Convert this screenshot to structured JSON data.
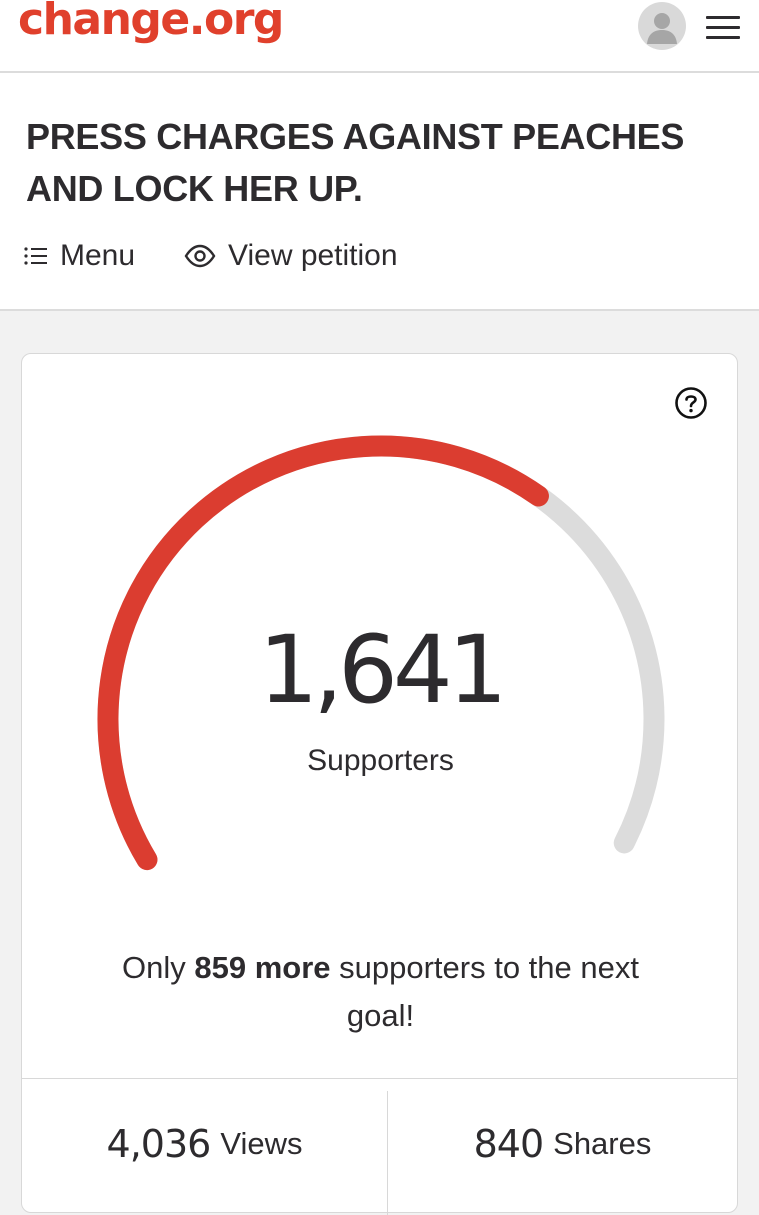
{
  "header": {
    "logo_text": "change.org",
    "brand_color": "#e0402c",
    "avatar_icon": "user-avatar-icon",
    "menu_icon": "hamburger-menu-icon"
  },
  "petition": {
    "title": "PRESS CHARGES AGAINST PEACHES AND LOCK HER UP.",
    "nav": {
      "menu_label": "Menu",
      "menu_icon": "list-icon",
      "view_label": "View petition",
      "view_icon": "eye-icon"
    }
  },
  "progress": {
    "help_icon": "question-circle-icon",
    "supporters_count": "1,641",
    "supporters_label": "Supporters",
    "goal_total": 2500,
    "supporters_value": 1641,
    "fill_fraction": 0.6564,
    "fill_color": "#db3d30",
    "track_color": "#dcdcdc",
    "goal_prefix": "Only ",
    "goal_bold": "859 more",
    "goal_suffix": " supporters to the next goal!"
  },
  "stats": {
    "views_count": "4,036",
    "views_label": "Views",
    "shares_count": "840",
    "shares_label": "Shares"
  }
}
